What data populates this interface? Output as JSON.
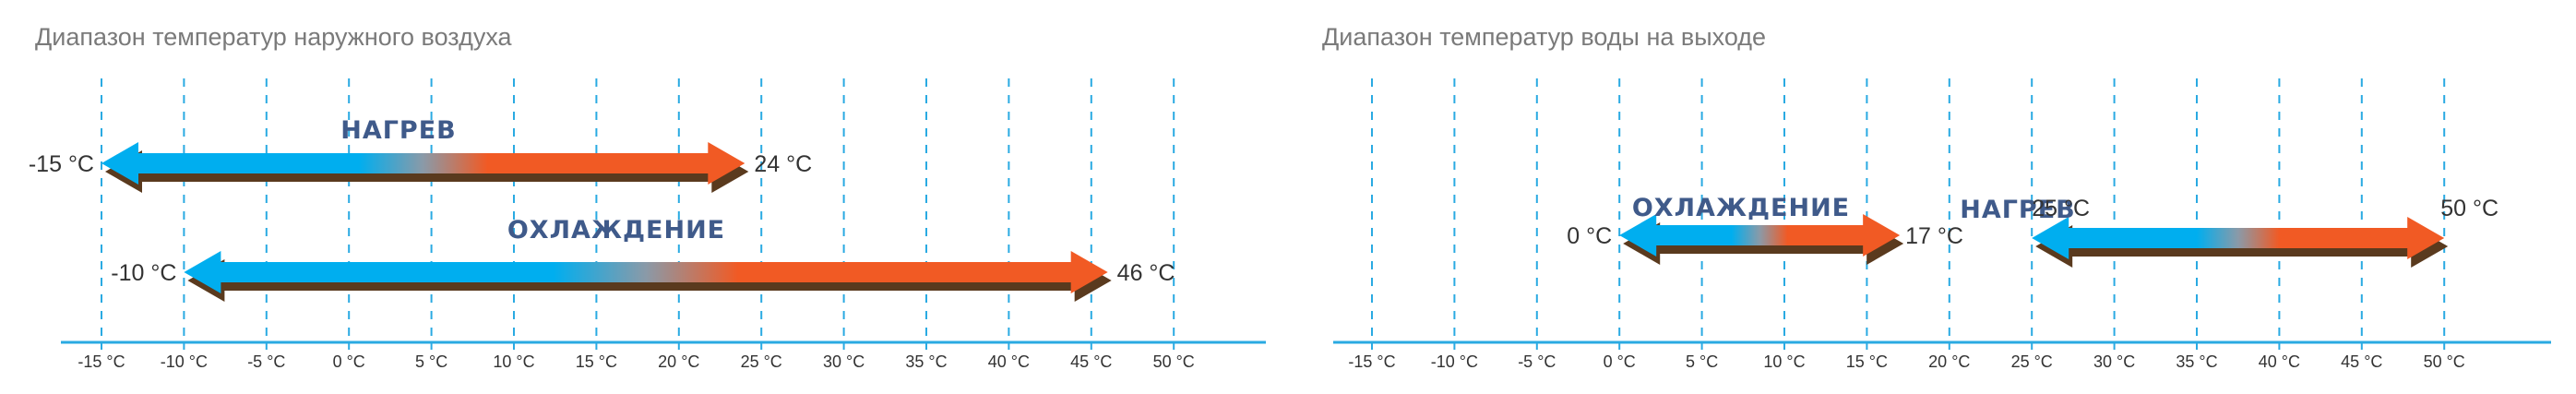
{
  "chart_data": [
    {
      "type": "range",
      "title": "Диапазон температур наружного воздуха",
      "x_ticks": [
        -15,
        -10,
        -5,
        0,
        5,
        10,
        15,
        20,
        25,
        30,
        35,
        40,
        45,
        50
      ],
      "tick_labels": [
        "-15 °C",
        "-10 °C",
        "-5 °C",
        "0 °C",
        "5 °C",
        "10 °C",
        "15 °C",
        "20 °C",
        "25 °C",
        "30 °C",
        "35 °C",
        "40 °C",
        "45 °C",
        "50 °C"
      ],
      "grid": true,
      "ranges": [
        {
          "name": "НАГРЕВ",
          "min": -15,
          "max": 24,
          "min_label": "-15 °C",
          "max_label": "24 °C"
        },
        {
          "name": "ОХЛАЖДЕНИЕ",
          "min": -10,
          "max": 46,
          "min_label": "-10 °C",
          "max_label": "46 °C"
        }
      ]
    },
    {
      "type": "range",
      "title": "Диапазон температур воды на выходе",
      "x_ticks": [
        -15,
        -10,
        -5,
        0,
        5,
        10,
        15,
        20,
        25,
        30,
        35,
        40,
        45,
        50
      ],
      "tick_labels": [
        "-15 °C",
        "-10 °C",
        "-5 °C",
        "0 °C",
        "5 °C",
        "10 °C",
        "15 °C",
        "20 °C",
        "25 °C",
        "30 °C",
        "35 °C",
        "40 °C",
        "45 °C",
        "50 °C"
      ],
      "grid": true,
      "ranges": [
        {
          "name": "ОХЛАЖДЕНИЕ",
          "min": 0,
          "max": 17,
          "min_label": "0 °C",
          "max_label": "17 °C"
        },
        {
          "name": "НАГРЕВ",
          "min": 25,
          "max": 50,
          "min_label": "25 °C",
          "max_label": "50 °C"
        }
      ]
    }
  ],
  "colors": {
    "cold": "#00aeef",
    "warm": "#f15a24",
    "arrow_shadow": "#5a3a1e",
    "grid": "#2aaae2",
    "axis": "#2aaae2",
    "title": "#7a7a7a",
    "mode_label": "#3f5a8a"
  }
}
